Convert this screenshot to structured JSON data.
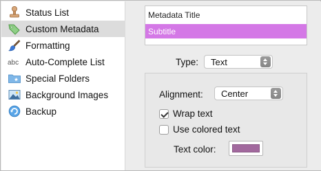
{
  "sidebar": {
    "items": [
      {
        "label": "Status List",
        "icon": "stamp-icon"
      },
      {
        "label": "Custom Metadata",
        "icon": "tag-icon",
        "selected": true
      },
      {
        "label": "Formatting",
        "icon": "paintbrush-icon"
      },
      {
        "label": "Auto-Complete List",
        "icon": "abc-icon"
      },
      {
        "label": "Special Folders",
        "icon": "folder-icon"
      },
      {
        "label": "Background Images",
        "icon": "image-icon"
      },
      {
        "label": "Backup",
        "icon": "backup-icon"
      }
    ]
  },
  "metadata_list": {
    "rows": [
      {
        "label": "Metadata Title"
      },
      {
        "label": "Subtitle",
        "selected": true
      }
    ]
  },
  "type_field": {
    "label": "Type:",
    "value": "Text"
  },
  "options": {
    "alignment": {
      "label": "Alignment:",
      "value": "Center"
    },
    "wrap_text": {
      "label": "Wrap text",
      "checked": true
    },
    "use_colored_text": {
      "label": "Use colored text",
      "checked": false
    },
    "text_color": {
      "label": "Text color:",
      "color": "#a2699e"
    }
  },
  "colors": {
    "selection_highlight": "#d478e6",
    "sidebar_selected": "#dcdcdc"
  }
}
